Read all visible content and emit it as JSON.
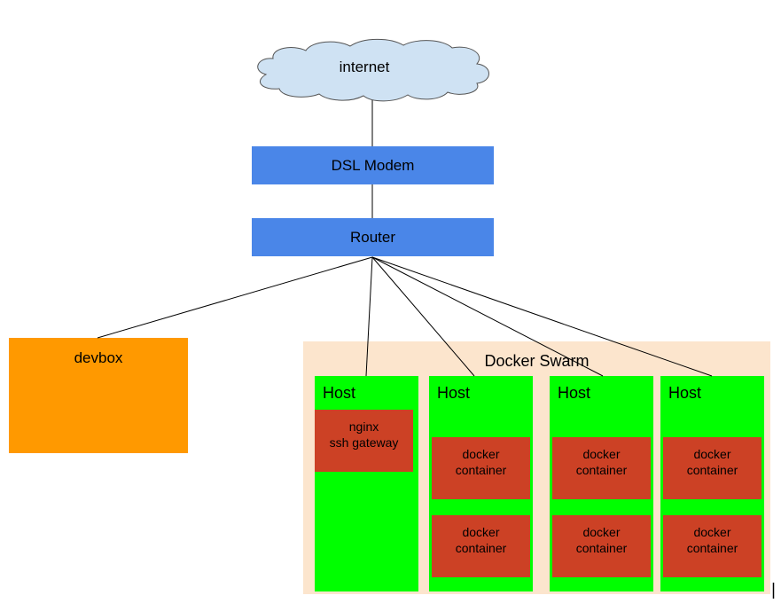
{
  "nodes": {
    "internet": "internet",
    "modem": "DSL Modem",
    "router": "Router",
    "devbox": "devbox",
    "swarm": "Docker Swarm",
    "hosts": [
      {
        "label": "Host",
        "containers": [
          {
            "line1": "nginx",
            "line2": "ssh gateway"
          }
        ]
      },
      {
        "label": "Host",
        "containers": [
          {
            "line1": "docker",
            "line2": "container"
          },
          {
            "line1": "docker",
            "line2": "container"
          }
        ]
      },
      {
        "label": "Host",
        "containers": [
          {
            "line1": "docker",
            "line2": "container"
          },
          {
            "line1": "docker",
            "line2": "container"
          }
        ]
      },
      {
        "label": "Host",
        "containers": [
          {
            "line1": "docker",
            "line2": "container"
          },
          {
            "line1": "docker",
            "line2": "container"
          }
        ]
      }
    ]
  },
  "colors": {
    "cloud": "#cfe2f3",
    "device": "#4a86e8",
    "devbox": "#ff9900",
    "swarm": "#fce5cd",
    "host": "#00ff00",
    "container": "#cc4125"
  }
}
